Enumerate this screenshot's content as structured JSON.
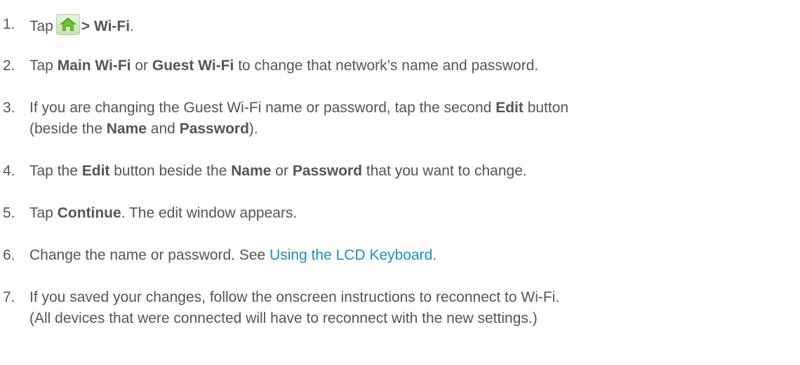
{
  "steps": [
    {
      "number": "1.",
      "tap": "Tap",
      "icon": "home-icon",
      "target": "> Wi-Fi",
      "end": "."
    },
    {
      "number": "2.",
      "tap": "Tap",
      "opt1": "Main Wi-Fi",
      "or": "or",
      "opt2": "Guest Wi-Fi",
      "rest": "to change that network’s name and password."
    },
    {
      "number": "3.",
      "line1": "If you are changing the Guest Wi-Fi name or password, tap the second",
      "edit": "Edit",
      "button": "button",
      "line2_open": "(beside the",
      "name": "Name",
      "and": "and",
      "password": "Password",
      "close": ")."
    },
    {
      "number": "4.",
      "tap_the": "Tap the",
      "edit": "Edit",
      "beside": "button beside the",
      "name": "Name",
      "or": "or",
      "password": "Password",
      "rest": "that you want to change."
    },
    {
      "number": "5.",
      "tap": "Tap",
      "continue": "Continue",
      "rest": ". The edit window appears."
    },
    {
      "number": "6.",
      "text": "Change the name or password. See",
      "link": "Using the LCD Keyboard",
      "end": "."
    },
    {
      "number": "7.",
      "line1": "If you saved your changes, follow the onscreen instructions to reconnect to Wi-Fi.",
      "line2": "(All devices that were connected will have to reconnect with the new settings.)"
    }
  ],
  "colors": {
    "text": "#555555",
    "link": "#1a8fc4",
    "icon_bg": "#6fb82e",
    "icon_house": "#ffffff"
  }
}
